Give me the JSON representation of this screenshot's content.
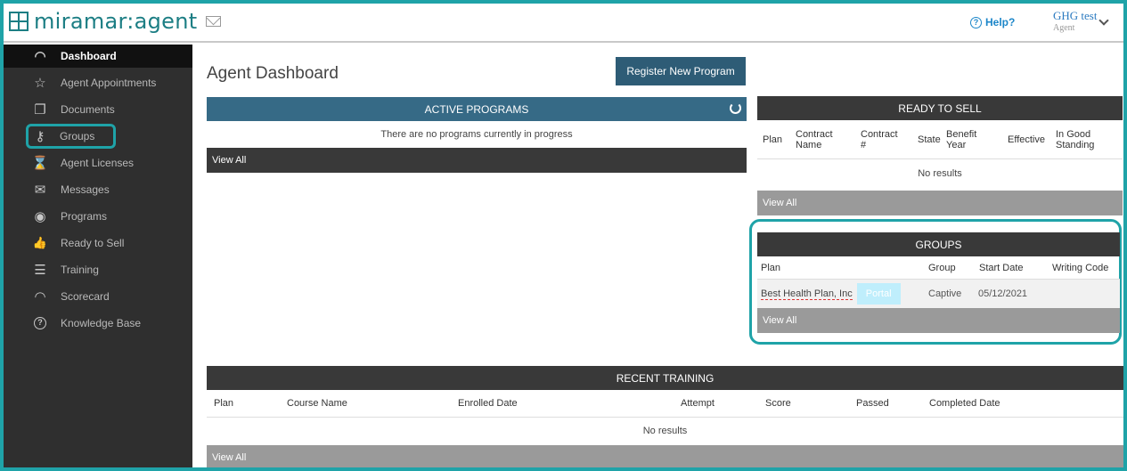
{
  "header": {
    "logo_text": "miramar:agent",
    "help_label": "Help?",
    "user_name": "GHG test",
    "user_role": "Agent"
  },
  "sidebar": {
    "items": [
      {
        "label": "Dashboard",
        "icon": "dashboard-gauge-icon",
        "glyph": "◠"
      },
      {
        "label": "Agent Appointments",
        "icon": "star-icon",
        "glyph": "☆"
      },
      {
        "label": "Documents",
        "icon": "document-icon",
        "glyph": "❐"
      },
      {
        "label": "Groups",
        "icon": "key-icon",
        "glyph": "⚷"
      },
      {
        "label": "Agent Licenses",
        "icon": "license-icon",
        "glyph": "⌛"
      },
      {
        "label": "Messages",
        "icon": "envelope-icon",
        "glyph": "✉"
      },
      {
        "label": "Programs",
        "icon": "eye-icon",
        "glyph": "◉"
      },
      {
        "label": "Ready to Sell",
        "icon": "thumbs-up-icon",
        "glyph": "👍"
      },
      {
        "label": "Training",
        "icon": "checklist-icon",
        "glyph": "☰"
      },
      {
        "label": "Scorecard",
        "icon": "scorecard-gauge-icon",
        "glyph": "◠"
      },
      {
        "label": "Knowledge Base",
        "icon": "question-circle-icon",
        "glyph": "?"
      }
    ]
  },
  "main": {
    "title": "Agent Dashboard",
    "register_button": "Register New Program",
    "active_programs": {
      "title": "ACTIVE PROGRAMS",
      "empty_text": "There are no programs currently in progress",
      "view_all": "View All"
    },
    "ready_to_sell": {
      "title": "READY TO SELL",
      "columns": [
        "Plan",
        "Contract Name",
        "Contract #",
        "State",
        "Benefit Year",
        "Effective",
        "In Good Standing"
      ],
      "empty_text": "No results",
      "view_all": "View All"
    },
    "groups": {
      "title": "GROUPS",
      "columns": [
        "Plan",
        "Group",
        "Start Date",
        "Writing Code"
      ],
      "rows": [
        {
          "plan": "Best Health Plan, Inc",
          "portal": "Portal",
          "group": "Captive",
          "start_date": "05/12/2021",
          "writing_code": ""
        }
      ],
      "view_all": "View All"
    },
    "recent_training": {
      "title": "RECENT TRAINING",
      "columns": [
        "Plan",
        "Course Name",
        "Enrolled Date",
        "Attempt",
        "Score",
        "Passed",
        "Completed Date"
      ],
      "empty_text": "No results",
      "view_all": "View All"
    }
  },
  "colors": {
    "accent": "#1fa3a8",
    "sidebar_bg": "#2f2f2f",
    "active_programs_header": "#366a86",
    "panel_header": "#393939"
  }
}
